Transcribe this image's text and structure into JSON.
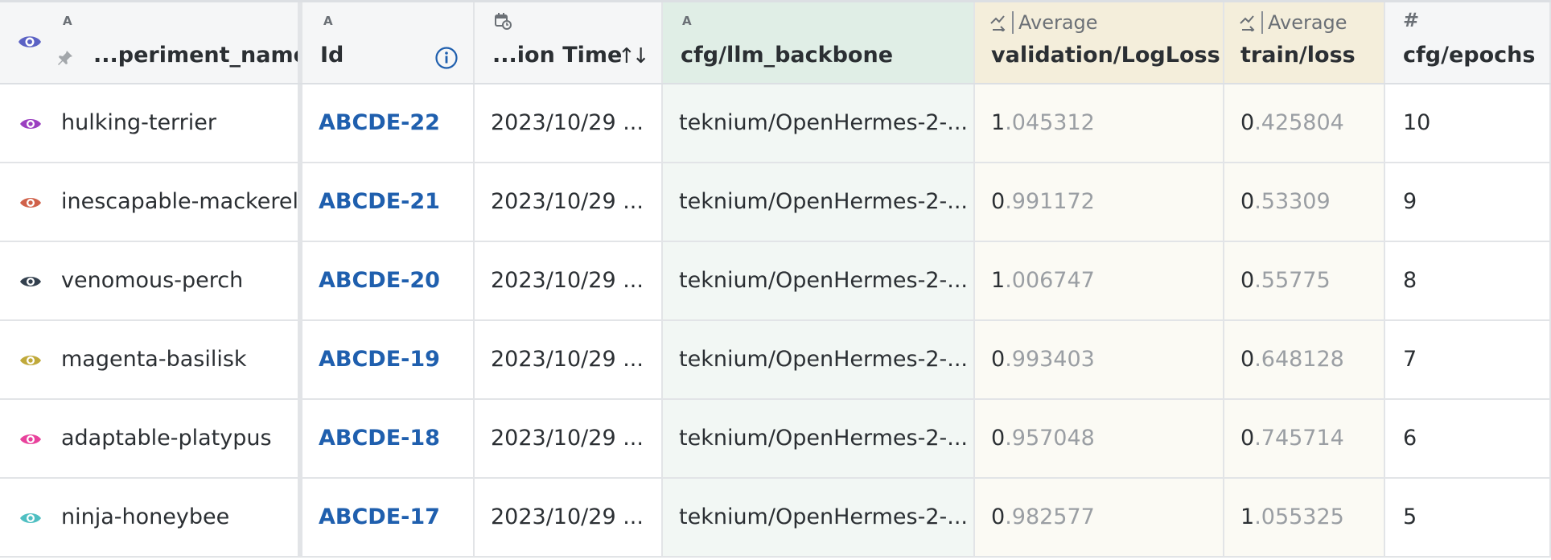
{
  "header": {
    "name": {
      "type_glyph": "A",
      "label": "...periment_name"
    },
    "id": {
      "type_glyph": "A",
      "label": "Id"
    },
    "time": {
      "label": "...ion Time",
      "sort_glyph": "↑↓"
    },
    "backbone": {
      "type_glyph": "A",
      "label": "cfg/llm_backbone"
    },
    "val_loss": {
      "agg": "Average",
      "label": "validation/LogLoss"
    },
    "train_loss": {
      "agg": "Average",
      "label": "train/loss"
    },
    "epochs": {
      "type_glyph": "#",
      "label": "cfg/epochs"
    }
  },
  "rows": [
    {
      "color": "#9b3fc0",
      "name": "hulking-terrier",
      "id": "ABCDE-22",
      "time": "2023/10/29 ...",
      "backbone": "teknium/OpenHermes-2-...",
      "val_int": "1",
      "val_frac": ".045312",
      "train_int": "0",
      "train_frac": ".425804",
      "epochs": "10"
    },
    {
      "color": "#d0614a",
      "name": "inescapable-mackerel",
      "id": "ABCDE-21",
      "time": "2023/10/29 ...",
      "backbone": "teknium/OpenHermes-2-...",
      "val_int": "0",
      "val_frac": ".991172",
      "train_int": "0",
      "train_frac": ".53309",
      "epochs": "9"
    },
    {
      "color": "#33404e",
      "name": "venomous-perch",
      "id": "ABCDE-20",
      "time": "2023/10/29 ...",
      "backbone": "teknium/OpenHermes-2-...",
      "val_int": "1",
      "val_frac": ".006747",
      "train_int": "0",
      "train_frac": ".55775",
      "epochs": "8"
    },
    {
      "color": "#c0a93a",
      "name": "magenta-basilisk",
      "id": "ABCDE-19",
      "time": "2023/10/29 ...",
      "backbone": "teknium/OpenHermes-2-...",
      "val_int": "0",
      "val_frac": ".993403",
      "train_int": "0",
      "train_frac": ".648128",
      "epochs": "7"
    },
    {
      "color": "#e8429c",
      "name": "adaptable-platypus",
      "id": "ABCDE-18",
      "time": "2023/10/29 ...",
      "backbone": "teknium/OpenHermes-2-...",
      "val_int": "0",
      "val_frac": ".957048",
      "train_int": "0",
      "train_frac": ".745714",
      "epochs": "6"
    },
    {
      "color": "#4fbfc2",
      "name": "ninja-honeybee",
      "id": "ABCDE-17",
      "time": "2023/10/29 ...",
      "backbone": "teknium/OpenHermes-2-...",
      "val_int": "0",
      "val_frac": ".982577",
      "train_int": "1",
      "train_frac": ".055325",
      "epochs": "5"
    }
  ],
  "colors": {
    "header_eye": "#5b62c4"
  }
}
